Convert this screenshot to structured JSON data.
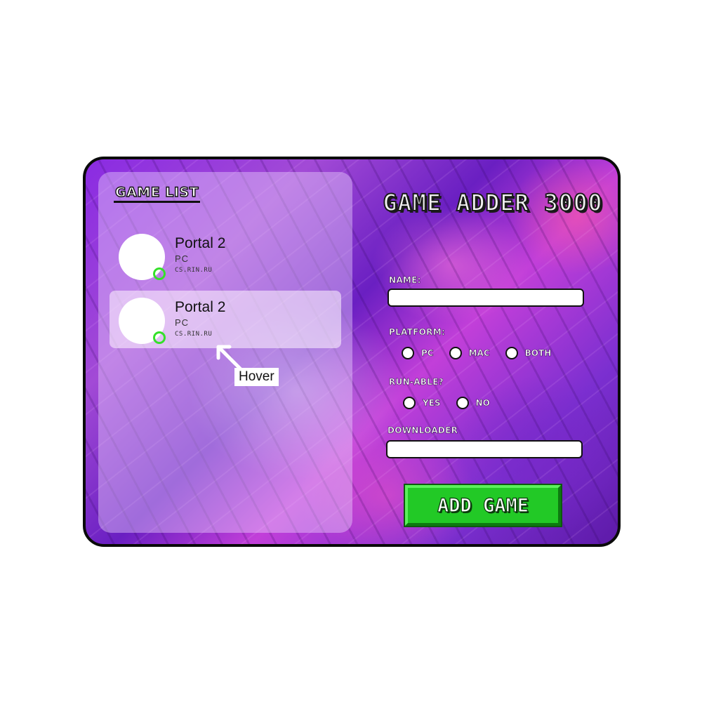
{
  "game_list": {
    "title": "GAME LIST",
    "items": [
      {
        "title": "Portal 2",
        "platform": "PC",
        "source": "CS.RIN.RU",
        "state": "normal"
      },
      {
        "title": "Portal 2",
        "platform": "PC",
        "source": "CS.RIN.RU",
        "state": "hover"
      }
    ],
    "hover_annotation": "Hover"
  },
  "adder": {
    "title": "GAME ADDER 3000",
    "name_label": "NAME:",
    "name_value": "",
    "platform_label": "PLATFORM:",
    "platform_options": [
      "PC",
      "MAC",
      "BOTH"
    ],
    "runnable_label": "RUN-ABLE?",
    "runnable_options": [
      "YES",
      "NO"
    ],
    "downloader_label": "DOWNLOADER",
    "downloader_value": "",
    "submit_label": "ADD GAME"
  },
  "colors": {
    "accent_green": "#22c926",
    "status_online": "#35e02a",
    "background_purple": "#8a2be2"
  },
  "icons": {
    "status": "online-ring-icon",
    "annotation": "arrow-up-left-icon"
  }
}
